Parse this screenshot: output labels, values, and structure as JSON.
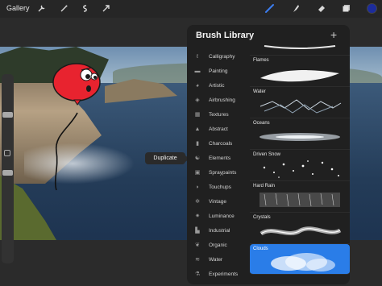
{
  "toolbar": {
    "gallery_label": "Gallery",
    "tools_left": [
      "wrench-icon",
      "wand-icon",
      "selection-icon",
      "transform-icon"
    ],
    "tools_right": [
      "brush-icon",
      "smudge-icon",
      "eraser-icon",
      "layers-icon"
    ],
    "current_color": "#1c2c9c",
    "active_tool_color": "#3c7df0"
  },
  "tooltip": {
    "duplicate_label": "Duplicate"
  },
  "brush_library": {
    "title": "Brush Library",
    "add_icon": "plus-icon",
    "sets": [
      {
        "label": "Calligraphy",
        "icon": "calligraphy-icon"
      },
      {
        "label": "Painting",
        "icon": "painting-icon"
      },
      {
        "label": "Artistic",
        "icon": "artistic-icon"
      },
      {
        "label": "Airbrushing",
        "icon": "airbrush-icon"
      },
      {
        "label": "Textures",
        "icon": "textures-icon"
      },
      {
        "label": "Abstract",
        "icon": "abstract-icon"
      },
      {
        "label": "Charcoals",
        "icon": "charcoals-icon"
      },
      {
        "label": "Elements",
        "icon": "elements-icon"
      },
      {
        "label": "Spraypaints",
        "icon": "spraypaints-icon"
      },
      {
        "label": "Touchups",
        "icon": "touchups-icon"
      },
      {
        "label": "Vintage",
        "icon": "vintage-icon"
      },
      {
        "label": "Luminance",
        "icon": "luminance-icon"
      },
      {
        "label": "Industrial",
        "icon": "industrial-icon"
      },
      {
        "label": "Organic",
        "icon": "organic-icon"
      },
      {
        "label": "Water",
        "icon": "water-icon"
      },
      {
        "label": "Experiments",
        "icon": "experiments-icon"
      }
    ],
    "brushes": [
      {
        "label": ""
      },
      {
        "label": "Flames"
      },
      {
        "label": "Water"
      },
      {
        "label": "Oceans"
      },
      {
        "label": "Driven Snow"
      },
      {
        "label": "Hard Rain"
      },
      {
        "label": "Crystals"
      },
      {
        "label": "Clouds",
        "selected": true
      }
    ],
    "selected_color": "#2a7de8"
  }
}
